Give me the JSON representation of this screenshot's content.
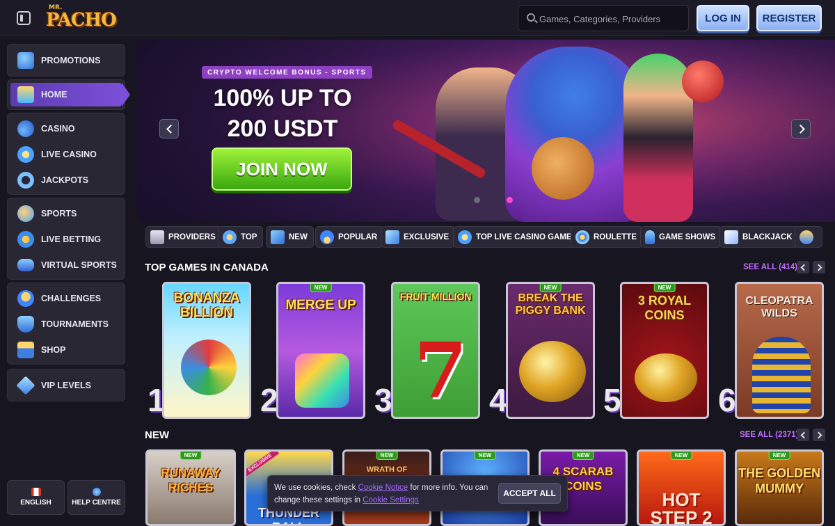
{
  "header": {
    "logo_small": "MR.",
    "logo_big": "PACHO",
    "search_placeholder": "Games, Categories, Providers",
    "login_label": "LOG IN",
    "register_label": "REGISTER"
  },
  "sidebar": {
    "groups": [
      {
        "items": [
          {
            "label": "PROMOTIONS",
            "icon": "gift-icon"
          }
        ]
      },
      {
        "items": [
          {
            "label": "HOME",
            "icon": "house-icon",
            "active": true
          }
        ]
      },
      {
        "items": [
          {
            "label": "CASINO",
            "icon": "cherries-icon"
          },
          {
            "label": "LIVE CASINO",
            "icon": "chip-icon"
          },
          {
            "label": "JACKPOTS",
            "icon": "magnet-icon"
          }
        ]
      },
      {
        "items": [
          {
            "label": "SPORTS",
            "icon": "ball-icon"
          },
          {
            "label": "LIVE BETTING",
            "icon": "play-icon"
          },
          {
            "label": "VIRTUAL SPORTS",
            "icon": "gamepad-icon"
          }
        ]
      },
      {
        "items": [
          {
            "label": "CHALLENGES",
            "icon": "medal-icon"
          },
          {
            "label": "TOURNAMENTS",
            "icon": "trophy-icon"
          },
          {
            "label": "SHOP",
            "icon": "basket-icon"
          }
        ]
      },
      {
        "items": [
          {
            "label": "VIP LEVELS",
            "icon": "diamond-icon"
          }
        ]
      }
    ],
    "language_label": "ENGLISH",
    "help_label": "HELP CENTRE"
  },
  "banner": {
    "tag": "CRYPTO WELCOME BONUS - SPORTS",
    "line1": "100% UP TO",
    "line2": "200 USDT",
    "cta": "JOIN NOW",
    "slides_total": 2,
    "active_slide": 2
  },
  "categories": [
    {
      "label": "PROVIDERS",
      "icon": "scroll-icon"
    },
    {
      "label": "TOP",
      "icon": "star-icon"
    },
    {
      "label": "NEW",
      "icon": "lightning-icon"
    },
    {
      "label": "POPULAR",
      "icon": "flame-icon"
    },
    {
      "label": "EXCLUSIVE",
      "icon": "diamond-icon"
    },
    {
      "label": "TOP LIVE CASINO GAMES",
      "icon": "chip-icon"
    },
    {
      "label": "ROULETTE",
      "icon": "roulette-icon"
    },
    {
      "label": "GAME SHOWS",
      "icon": "microphone-icon"
    },
    {
      "label": "BLACKJACK",
      "icon": "cards-icon"
    }
  ],
  "top_games": {
    "title": "TOP GAMES IN CANADA",
    "see_all": "SEE ALL (414)",
    "games": [
      {
        "rank": "1",
        "title": "BONANZA BILLION",
        "new": false
      },
      {
        "rank": "2",
        "title": "MERGE UP",
        "new": true
      },
      {
        "rank": "3",
        "title": "FRUIT MILLION",
        "new": false
      },
      {
        "rank": "4",
        "title": "BREAK THE PIGGY BANK",
        "new": true
      },
      {
        "rank": "5",
        "title": "3 ROYAL COINS",
        "new": true
      },
      {
        "rank": "6",
        "title": "CLEOPATRA WILDS",
        "new": false
      }
    ]
  },
  "new_games": {
    "title": "NEW",
    "see_all": "SEE ALL (2371)",
    "games": [
      {
        "title": "RUNAWAY RICHES",
        "new": true
      },
      {
        "title": "THUNDER BALL",
        "new": false,
        "exclusive": true,
        "exclusive_label": "EXCLUSIVE"
      },
      {
        "title": "WRATH OF HEPHAESTUS",
        "new": true
      },
      {
        "title": "",
        "new": true
      },
      {
        "title": "4 SCARAB COINS",
        "new": true
      },
      {
        "title": "HOT STEP 2",
        "new": true
      },
      {
        "title": "THE GOLDEN MUMMY",
        "new": true
      }
    ],
    "new_badge": "NEW"
  },
  "cookie": {
    "text1": "We use cookies, check ",
    "link1": "Cookie Notice",
    "text2": " for more info. You can change these settings in ",
    "link2": "Cookie Settings",
    "accept": "ACCEPT ALL"
  }
}
